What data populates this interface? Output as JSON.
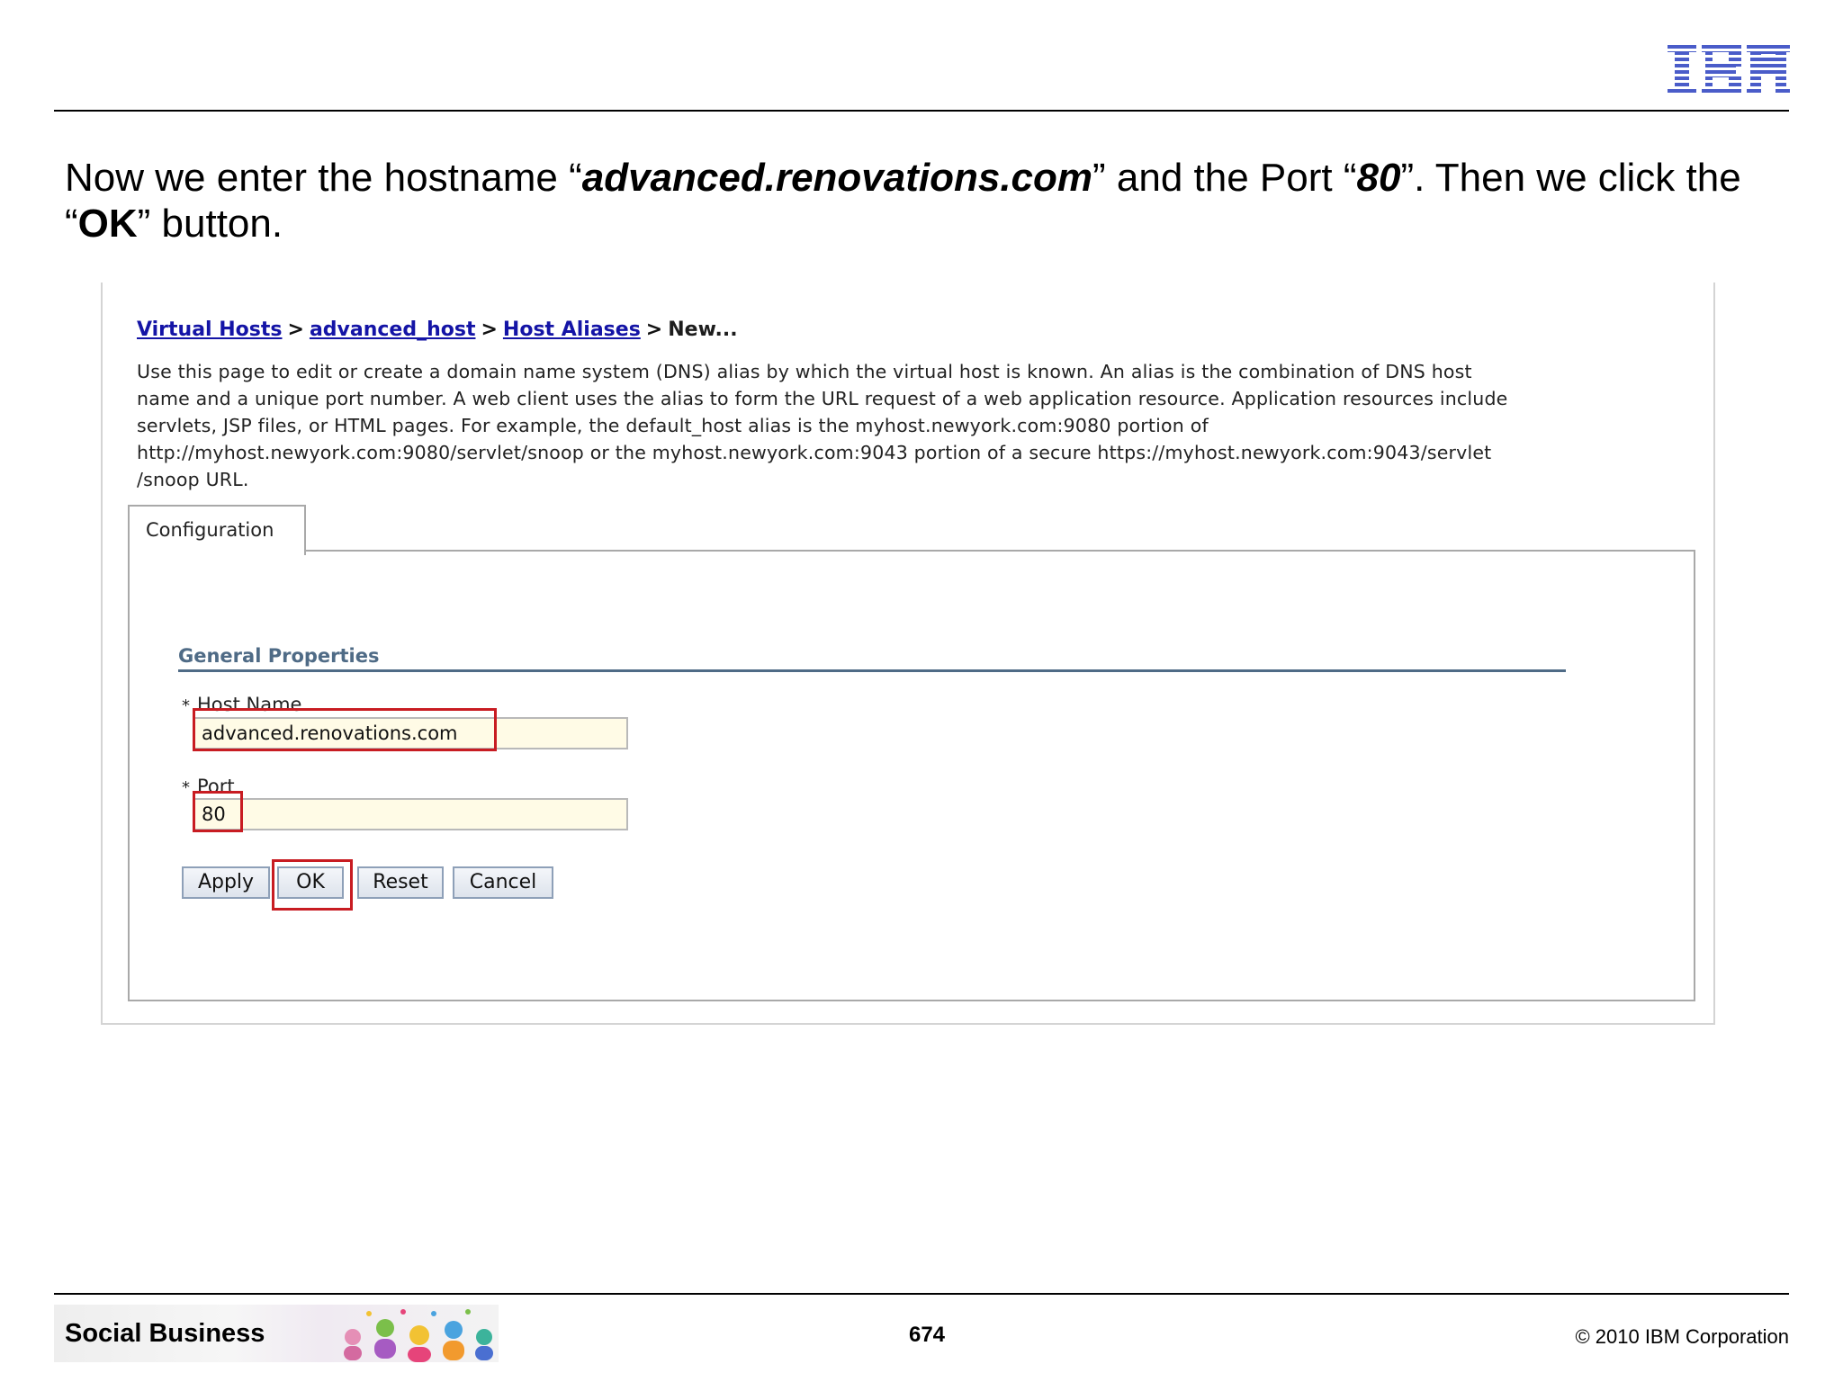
{
  "header": {
    "logo_text": "IBM"
  },
  "instruction": {
    "prefix": "Now we enter the hostname “",
    "hostname": "advanced.renovations.com",
    "middle": "” and the Port “",
    "port": "80",
    "suffix": "”. Then we click the",
    "line2_open": "“",
    "ok": "OK",
    "line2_close": "” button."
  },
  "breadcrumb": {
    "items": [
      "Virtual Hosts",
      "advanced_host",
      "Host Aliases"
    ],
    "separator": ">",
    "current": "New..."
  },
  "description": {
    "lines": [
      "Use this page to edit or create a domain name system (DNS) alias by which the virtual host is known. An alias is the combination of DNS host",
      "name and a unique port number. A web client uses the alias to form the URL request of a web application resource. Application resources include",
      "servlets, JSP files, or HTML pages. For example, the default_host alias is the myhost.newyork.com:9080 portion of",
      "http://myhost.newyork.com:9080/servlet/snoop or the myhost.newyork.com:9043 portion of a secure https://myhost.newyork.com:9043/servlet",
      "/snoop URL."
    ]
  },
  "tab": {
    "label": "Configuration"
  },
  "form": {
    "section_title": "General Properties",
    "required_marker": "*",
    "host_label": "Host Name",
    "host_value": "advanced.renovations.com",
    "port_label": "Port",
    "port_value": "80"
  },
  "buttons": {
    "apply": "Apply",
    "ok": "OK",
    "reset": "Reset",
    "cancel": "Cancel"
  },
  "footer": {
    "brand": "Social Business",
    "page_number": "674",
    "copyright": "© 2010 IBM Corporation"
  },
  "colors": {
    "highlight": "#c81c22",
    "link": "#1414a6",
    "section": "#4f6b86",
    "input_bg": "#fffbe6"
  }
}
